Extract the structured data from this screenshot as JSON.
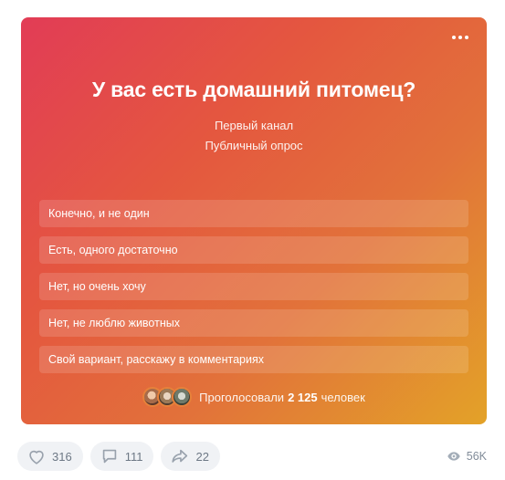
{
  "poll": {
    "title": "У вас есть домашний питомец?",
    "author": "Первый канал",
    "type": "Публичный опрос",
    "options": [
      "Конечно, и не один",
      "Есть, одного достаточно",
      "Нет, но очень хочу",
      "Нет, не люблю животных",
      "Свой вариант, расскажу в комментариях"
    ],
    "voted_prefix": "Проголосовали",
    "voted_count": "2 125",
    "voted_suffix": "человек"
  },
  "footer": {
    "likes": "316",
    "comments": "111",
    "shares": "22",
    "views": "56K"
  },
  "icons": {
    "more": "more-horizontal-icon",
    "like": "heart-icon",
    "comment": "comment-icon",
    "share": "share-arrow-icon",
    "views": "eye-icon"
  },
  "colors": {
    "gradient_start": "#e23c56",
    "gradient_end": "#e3a228",
    "footer_pill": "#f0f2f5",
    "footer_text": "#6d7885"
  }
}
